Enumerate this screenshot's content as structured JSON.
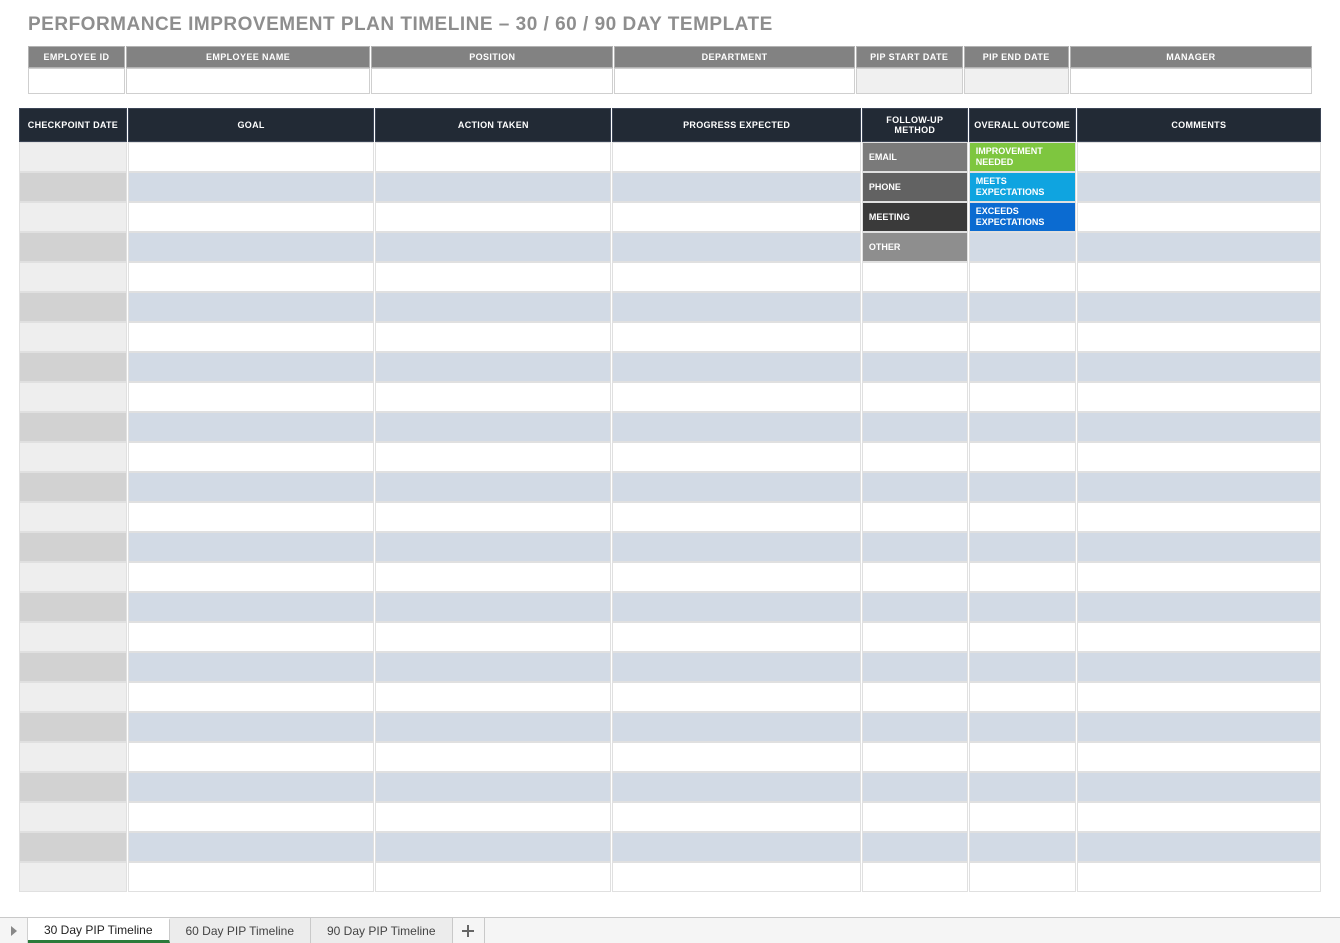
{
  "title": "PERFORMANCE IMPROVEMENT PLAN TIMELINE  –  30 / 60 / 90 DAY TEMPLATE",
  "employee_headers": {
    "id": "EMPLOYEE ID",
    "name": "EMPLOYEE NAME",
    "position": "POSITION",
    "department": "DEPARTMENT",
    "start": "PIP START DATE",
    "end": "PIP END DATE",
    "manager": "MANAGER"
  },
  "employee_values": {
    "id": "",
    "name": "",
    "position": "",
    "department": "",
    "start": "",
    "end": "",
    "manager": ""
  },
  "timeline_headers": {
    "checkpoint": "CHECKPOINT DATE",
    "goal": "GOAL",
    "action": "ACTION TAKEN",
    "progress": "PROGRESS EXPECTED",
    "followup": "FOLLOW-UP METHOD",
    "outcome": "OVERALL OUTCOME",
    "comments": "COMMENTS"
  },
  "followup_options": {
    "email": "EMAIL",
    "phone": "PHONE",
    "meeting": "MEETING",
    "other": "OTHER"
  },
  "outcome_options": {
    "improve": "IMPROVEMENT NEEDED",
    "meets": "MEETS EXPECTATIONS",
    "exceeds": "EXCEEDS EXPECTATIONS"
  },
  "colors": {
    "outcome_improve": "#7ec63f",
    "outcome_meets": "#0fa4e0",
    "outcome_exceeds": "#0b6bd1"
  },
  "sheet_tabs": {
    "t1": "30 Day PIP Timeline",
    "t2": "60 Day PIP Timeline",
    "t3": "90 Day PIP Timeline"
  }
}
